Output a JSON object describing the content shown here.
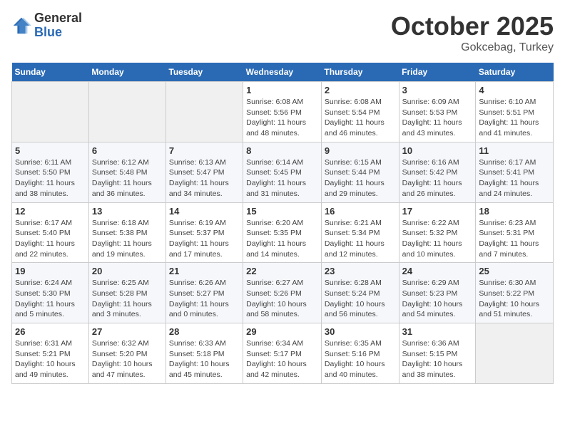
{
  "logo": {
    "general": "General",
    "blue": "Blue"
  },
  "header": {
    "title": "October 2025",
    "subtitle": "Gokcebag, Turkey"
  },
  "weekdays": [
    "Sunday",
    "Monday",
    "Tuesday",
    "Wednesday",
    "Thursday",
    "Friday",
    "Saturday"
  ],
  "weeks": [
    [
      {
        "day": "",
        "info": ""
      },
      {
        "day": "",
        "info": ""
      },
      {
        "day": "",
        "info": ""
      },
      {
        "day": "1",
        "info": "Sunrise: 6:08 AM\nSunset: 5:56 PM\nDaylight: 11 hours and 48 minutes."
      },
      {
        "day": "2",
        "info": "Sunrise: 6:08 AM\nSunset: 5:54 PM\nDaylight: 11 hours and 46 minutes."
      },
      {
        "day": "3",
        "info": "Sunrise: 6:09 AM\nSunset: 5:53 PM\nDaylight: 11 hours and 43 minutes."
      },
      {
        "day": "4",
        "info": "Sunrise: 6:10 AM\nSunset: 5:51 PM\nDaylight: 11 hours and 41 minutes."
      }
    ],
    [
      {
        "day": "5",
        "info": "Sunrise: 6:11 AM\nSunset: 5:50 PM\nDaylight: 11 hours and 38 minutes."
      },
      {
        "day": "6",
        "info": "Sunrise: 6:12 AM\nSunset: 5:48 PM\nDaylight: 11 hours and 36 minutes."
      },
      {
        "day": "7",
        "info": "Sunrise: 6:13 AM\nSunset: 5:47 PM\nDaylight: 11 hours and 34 minutes."
      },
      {
        "day": "8",
        "info": "Sunrise: 6:14 AM\nSunset: 5:45 PM\nDaylight: 11 hours and 31 minutes."
      },
      {
        "day": "9",
        "info": "Sunrise: 6:15 AM\nSunset: 5:44 PM\nDaylight: 11 hours and 29 minutes."
      },
      {
        "day": "10",
        "info": "Sunrise: 6:16 AM\nSunset: 5:42 PM\nDaylight: 11 hours and 26 minutes."
      },
      {
        "day": "11",
        "info": "Sunrise: 6:17 AM\nSunset: 5:41 PM\nDaylight: 11 hours and 24 minutes."
      }
    ],
    [
      {
        "day": "12",
        "info": "Sunrise: 6:17 AM\nSunset: 5:40 PM\nDaylight: 11 hours and 22 minutes."
      },
      {
        "day": "13",
        "info": "Sunrise: 6:18 AM\nSunset: 5:38 PM\nDaylight: 11 hours and 19 minutes."
      },
      {
        "day": "14",
        "info": "Sunrise: 6:19 AM\nSunset: 5:37 PM\nDaylight: 11 hours and 17 minutes."
      },
      {
        "day": "15",
        "info": "Sunrise: 6:20 AM\nSunset: 5:35 PM\nDaylight: 11 hours and 14 minutes."
      },
      {
        "day": "16",
        "info": "Sunrise: 6:21 AM\nSunset: 5:34 PM\nDaylight: 11 hours and 12 minutes."
      },
      {
        "day": "17",
        "info": "Sunrise: 6:22 AM\nSunset: 5:32 PM\nDaylight: 11 hours and 10 minutes."
      },
      {
        "day": "18",
        "info": "Sunrise: 6:23 AM\nSunset: 5:31 PM\nDaylight: 11 hours and 7 minutes."
      }
    ],
    [
      {
        "day": "19",
        "info": "Sunrise: 6:24 AM\nSunset: 5:30 PM\nDaylight: 11 hours and 5 minutes."
      },
      {
        "day": "20",
        "info": "Sunrise: 6:25 AM\nSunset: 5:28 PM\nDaylight: 11 hours and 3 minutes."
      },
      {
        "day": "21",
        "info": "Sunrise: 6:26 AM\nSunset: 5:27 PM\nDaylight: 11 hours and 0 minutes."
      },
      {
        "day": "22",
        "info": "Sunrise: 6:27 AM\nSunset: 5:26 PM\nDaylight: 10 hours and 58 minutes."
      },
      {
        "day": "23",
        "info": "Sunrise: 6:28 AM\nSunset: 5:24 PM\nDaylight: 10 hours and 56 minutes."
      },
      {
        "day": "24",
        "info": "Sunrise: 6:29 AM\nSunset: 5:23 PM\nDaylight: 10 hours and 54 minutes."
      },
      {
        "day": "25",
        "info": "Sunrise: 6:30 AM\nSunset: 5:22 PM\nDaylight: 10 hours and 51 minutes."
      }
    ],
    [
      {
        "day": "26",
        "info": "Sunrise: 6:31 AM\nSunset: 5:21 PM\nDaylight: 10 hours and 49 minutes."
      },
      {
        "day": "27",
        "info": "Sunrise: 6:32 AM\nSunset: 5:20 PM\nDaylight: 10 hours and 47 minutes."
      },
      {
        "day": "28",
        "info": "Sunrise: 6:33 AM\nSunset: 5:18 PM\nDaylight: 10 hours and 45 minutes."
      },
      {
        "day": "29",
        "info": "Sunrise: 6:34 AM\nSunset: 5:17 PM\nDaylight: 10 hours and 42 minutes."
      },
      {
        "day": "30",
        "info": "Sunrise: 6:35 AM\nSunset: 5:16 PM\nDaylight: 10 hours and 40 minutes."
      },
      {
        "day": "31",
        "info": "Sunrise: 6:36 AM\nSunset: 5:15 PM\nDaylight: 10 hours and 38 minutes."
      },
      {
        "day": "",
        "info": ""
      }
    ]
  ]
}
